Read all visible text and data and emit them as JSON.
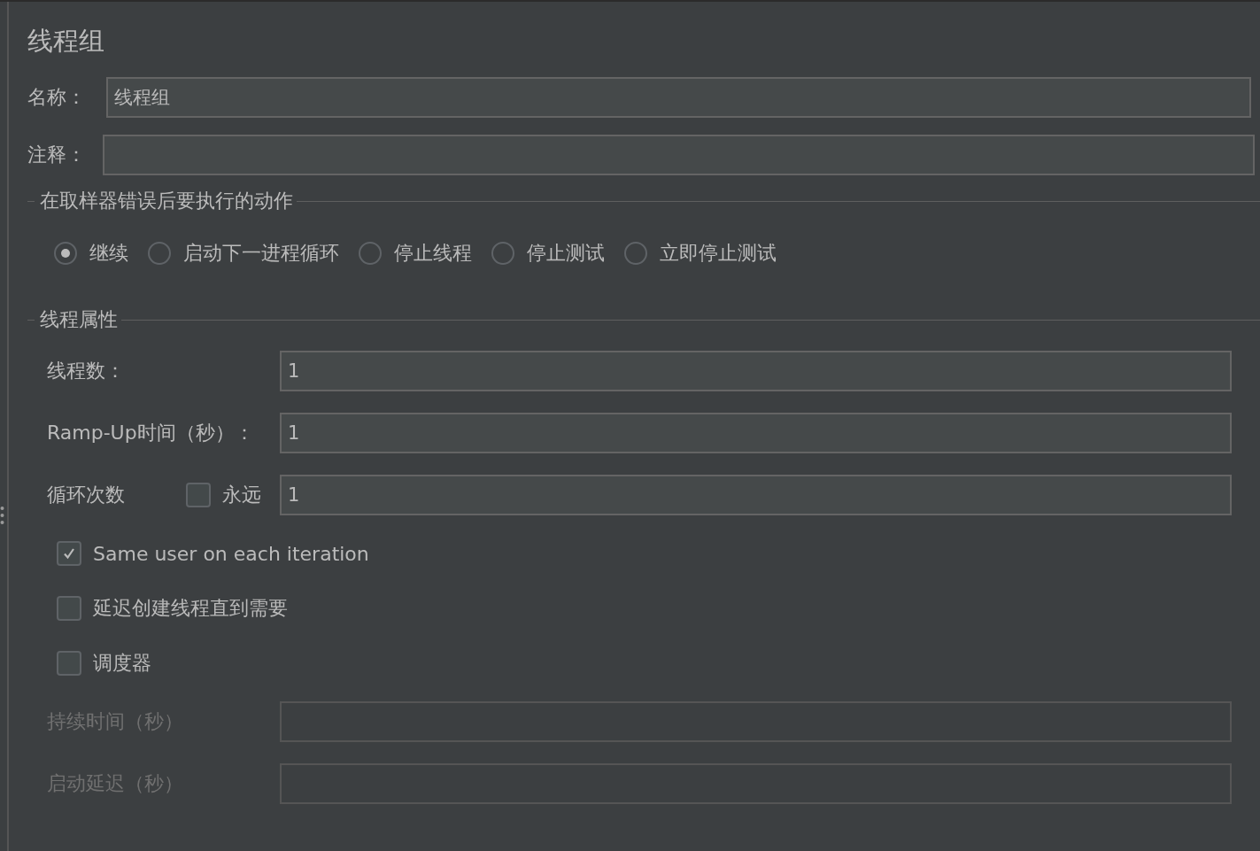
{
  "title": "线程组",
  "name": {
    "label": "名称：",
    "value": "线程组"
  },
  "comment": {
    "label": "注释："
  },
  "error_action": {
    "legend": "在取样器错误后要执行的动作",
    "options": [
      {
        "label": "继续",
        "selected": true
      },
      {
        "label": "启动下一进程循环",
        "selected": false
      },
      {
        "label": "停止线程",
        "selected": false
      },
      {
        "label": "停止测试",
        "selected": false
      },
      {
        "label": "立即停止测试",
        "selected": false
      }
    ]
  },
  "thread_properties": {
    "legend": "线程属性",
    "items": [
      {
        "kind": "field",
        "label": "线程数：",
        "value": "1",
        "disabled": false
      },
      {
        "kind": "field",
        "label": "Ramp-Up时间（秒）：",
        "value": "1",
        "disabled": false
      },
      {
        "kind": "loop",
        "label": "循环次数",
        "forever": {
          "label": "永远",
          "checked": false
        },
        "value": "1",
        "disabled": false
      },
      {
        "kind": "checkbox",
        "label": "Same user on each iteration",
        "checked": true
      },
      {
        "kind": "checkbox",
        "label": "延迟创建线程直到需要",
        "checked": false
      },
      {
        "kind": "checkbox",
        "label": "调度器",
        "checked": false
      },
      {
        "kind": "field",
        "label": "持续时间（秒）",
        "disabled": true
      },
      {
        "kind": "field",
        "label": "启动延迟（秒）",
        "disabled": true
      }
    ]
  }
}
